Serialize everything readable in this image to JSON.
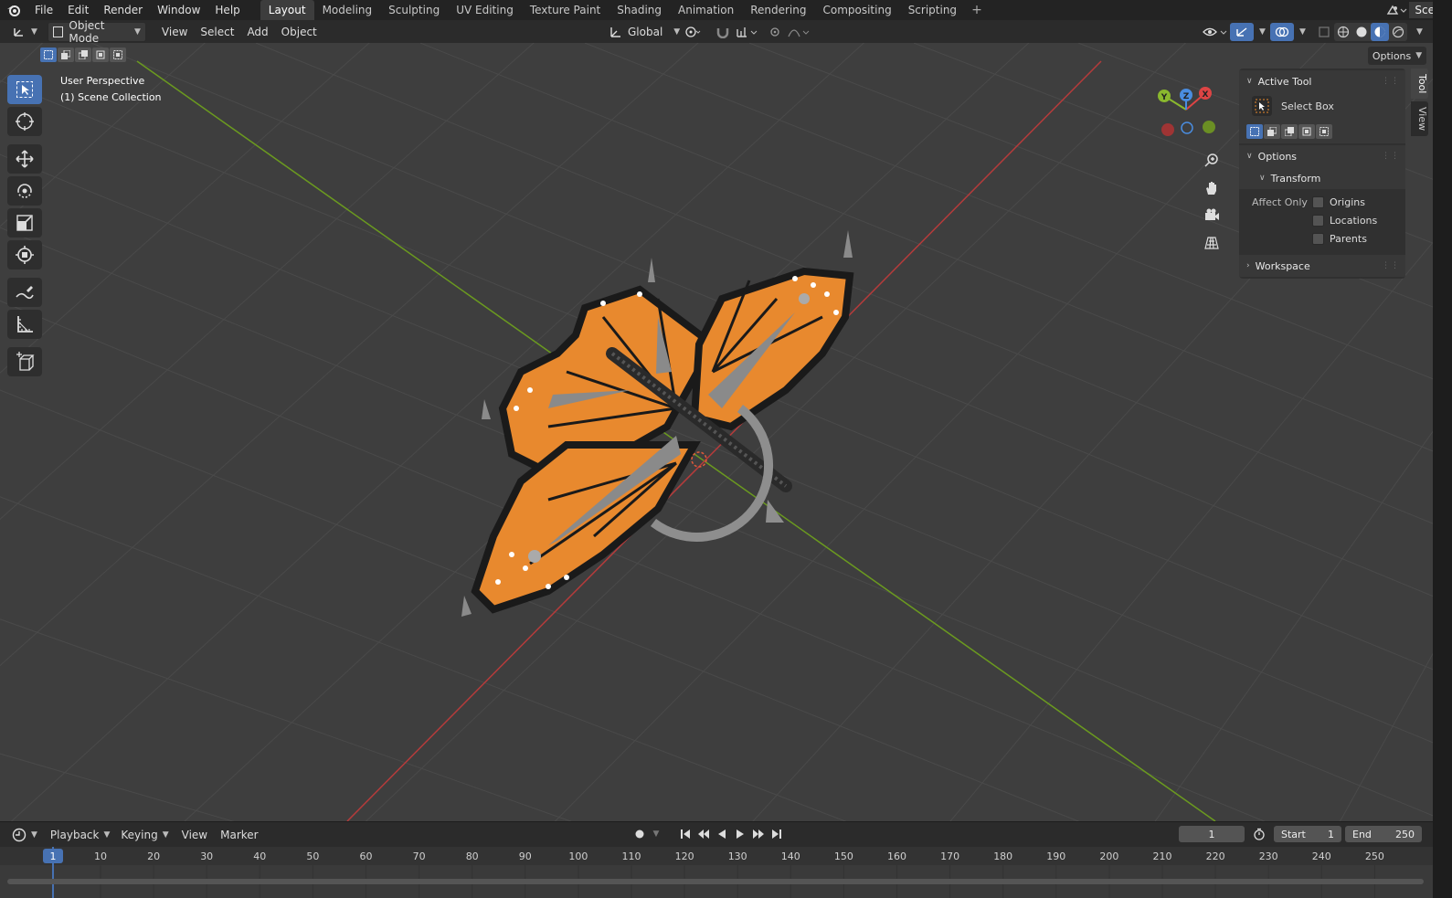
{
  "topbar": {
    "logo_icon": "blender-logo-icon",
    "menus": [
      "File",
      "Edit",
      "Render",
      "Window",
      "Help"
    ],
    "workspaces": [
      "Layout",
      "Modeling",
      "Sculpting",
      "UV Editing",
      "Texture Paint",
      "Shading",
      "Animation",
      "Rendering",
      "Compositing",
      "Scripting"
    ],
    "active_workspace": "Layout",
    "add_tab": "+",
    "scene_label": "Scene"
  },
  "header": {
    "mode": "Object Mode",
    "menus": [
      "View",
      "Select",
      "Add",
      "Object"
    ],
    "transform_orientation": "Global",
    "options_label": "Options"
  },
  "viewport": {
    "perspective": "User Perspective",
    "collection": "(1) Scene Collection",
    "colors": {
      "background": "#3e3e3e",
      "x_axis": "#b53b3b",
      "y_axis": "#6b9a1f",
      "wing": "#e8892e",
      "wing_dark": "#1a1a1a"
    },
    "gizmo": {
      "x": "X",
      "y": "Y",
      "z": "Z"
    }
  },
  "npanel": {
    "tabs": [
      "Tool",
      "View"
    ],
    "active_tool_title": "Active Tool",
    "active_tool_name": "Select Box",
    "options_title": "Options",
    "transform_title": "Transform",
    "affect_only_label": "Affect Only",
    "affect_items": [
      "Origins",
      "Locations",
      "Parents"
    ],
    "workspace_title": "Workspace"
  },
  "timeline": {
    "menus": [
      "Playback",
      "Keying",
      "View",
      "Marker"
    ],
    "current_frame": "1",
    "start_label": "Start",
    "start_value": "1",
    "end_label": "End",
    "end_value": "250",
    "ticks": [
      "1",
      "10",
      "20",
      "30",
      "40",
      "50",
      "60",
      "70",
      "80",
      "90",
      "100",
      "110",
      "120",
      "130",
      "140",
      "150",
      "160",
      "170",
      "180",
      "190",
      "200",
      "210",
      "220",
      "230",
      "240",
      "250"
    ]
  }
}
